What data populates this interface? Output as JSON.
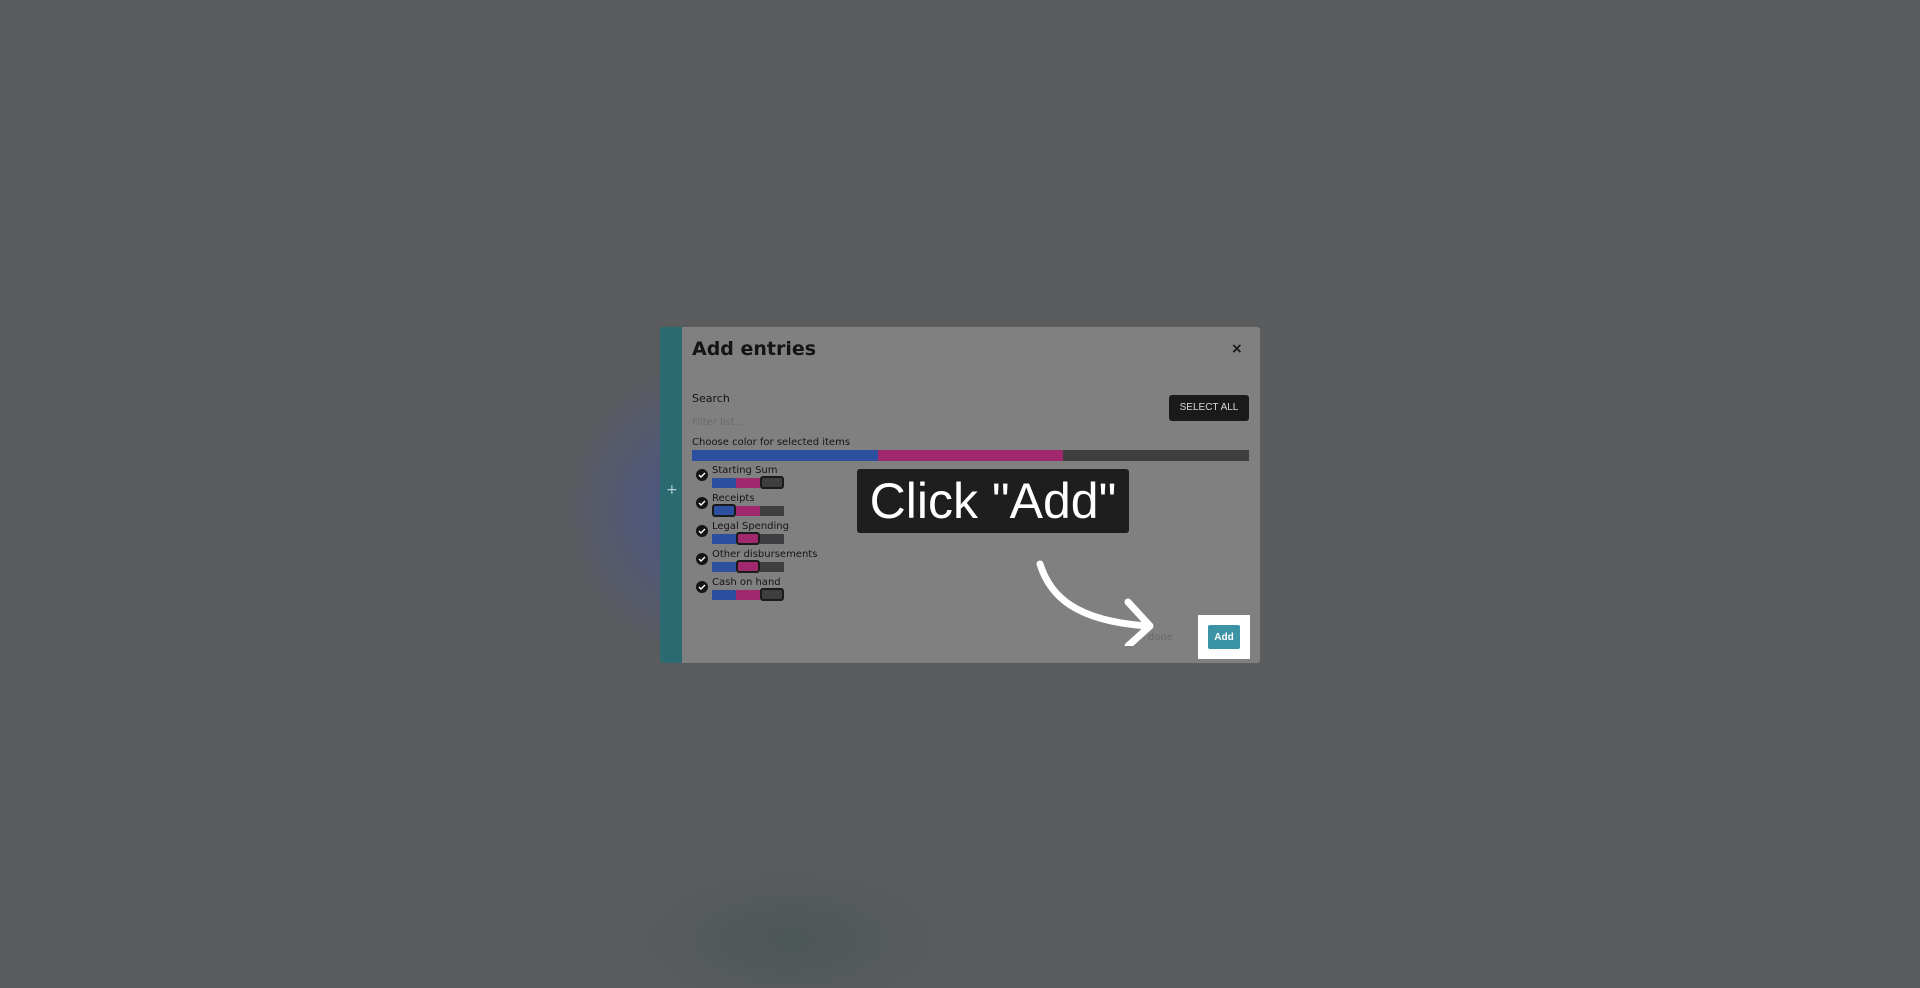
{
  "dialog": {
    "title": "Add entries",
    "close_label": "×",
    "search_label": "Search",
    "filter_placeholder": "Filter list...",
    "select_all_label": "SELECT ALL",
    "color_label": "Choose color for selected items",
    "colors": [
      "#2d4fa0",
      "#a0286e",
      "#3e3e40"
    ],
    "items": [
      {
        "label": "Starting Sum",
        "checked": true,
        "selected_color": "#3e3e40"
      },
      {
        "label": "Receipts",
        "checked": true,
        "selected_color": "#2d4fa0"
      },
      {
        "label": "Legal Spending",
        "checked": true,
        "selected_color": "#a0286e"
      },
      {
        "label": "Other disbursements",
        "checked": true,
        "selected_color": "#a0286e"
      },
      {
        "label": "Cash on hand",
        "checked": true,
        "selected_color": "#3e3e40"
      }
    ],
    "done_label": "done",
    "add_label": "Add"
  },
  "overlay": {
    "instruction": "Click \"Add\""
  },
  "sidebar_strip": {
    "icon": "plus-icon",
    "glyph": "+",
    "color": "#2c6a72"
  }
}
